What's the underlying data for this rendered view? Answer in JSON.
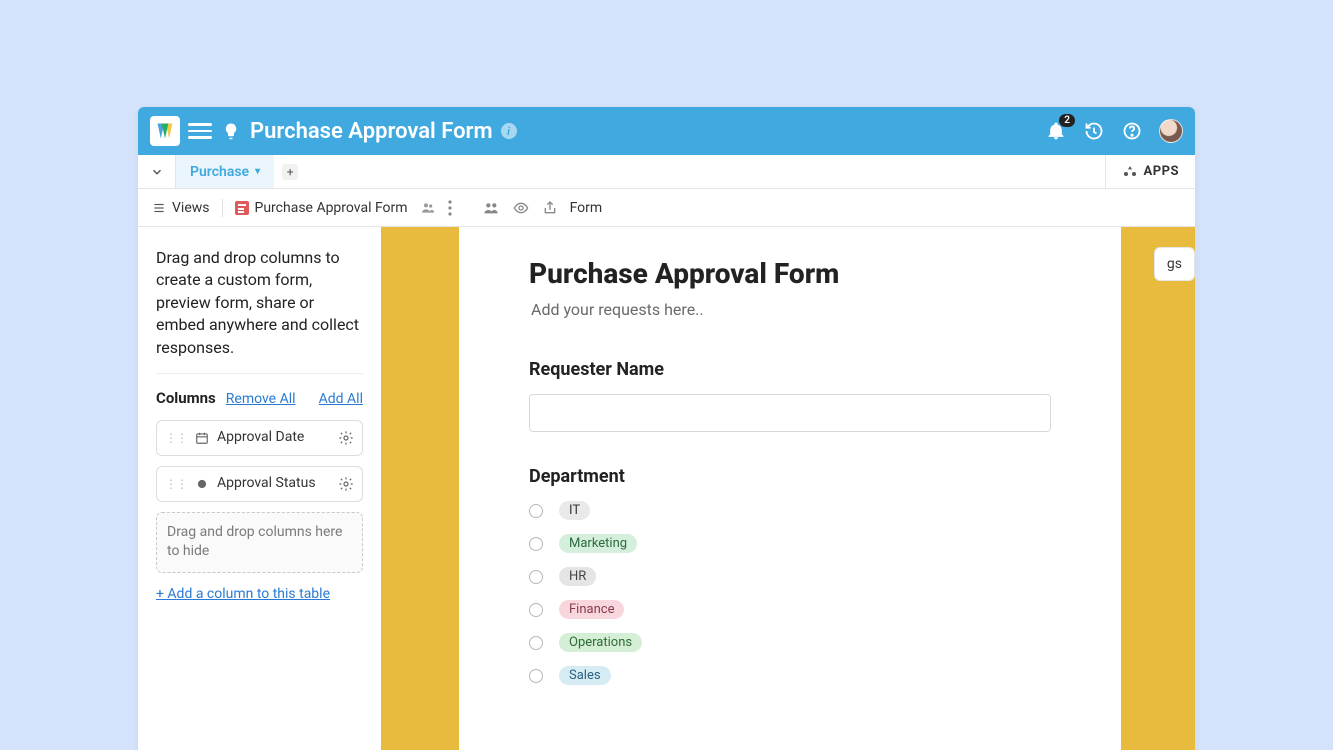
{
  "header": {
    "title": "Purchase Approval Form",
    "notification_count": "2"
  },
  "tabs": {
    "active": "Purchase",
    "apps_label": "APPS"
  },
  "viewbar": {
    "views_label": "Views",
    "current_view": "Purchase Approval Form",
    "form_label": "Form"
  },
  "sidebar": {
    "intro": "Drag and drop columns to create a custom form, preview form, share or embed anywhere and collect responses.",
    "columns_label": "Columns",
    "remove_all": "Remove All",
    "add_all": "Add All",
    "items": [
      {
        "label": "Approval Date"
      },
      {
        "label": "Approval Status"
      }
    ],
    "dropzone": "Drag and drop columns here to hide",
    "add_column": "+ Add a column to this table"
  },
  "settings_chip": "gs",
  "form": {
    "title": "Purchase Approval Form",
    "subtitle": "Add your requests here..",
    "fields": {
      "requester_label": "Requester Name",
      "department_label": "Department",
      "departments": [
        {
          "name": "IT",
          "cls": "pill-it"
        },
        {
          "name": "Marketing",
          "cls": "pill-mkt"
        },
        {
          "name": "HR",
          "cls": "pill-hr"
        },
        {
          "name": "Finance",
          "cls": "pill-fin"
        },
        {
          "name": "Operations",
          "cls": "pill-ops"
        },
        {
          "name": "Sales",
          "cls": "pill-sales"
        }
      ]
    }
  }
}
